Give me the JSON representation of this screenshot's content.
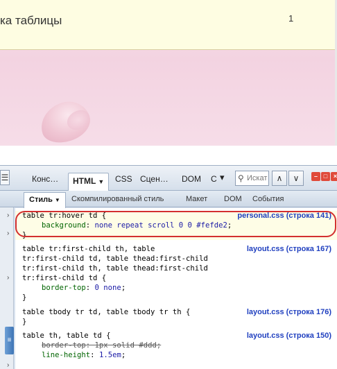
{
  "webpage": {
    "row_text": "ка таблицы",
    "row_number": "1"
  },
  "devtools": {
    "tabs": [
      {
        "label": "Конс…"
      },
      {
        "label": "HTML",
        "active": true
      },
      {
        "label": "CSS"
      },
      {
        "label": "Сцен…"
      },
      {
        "label": "DOM"
      },
      {
        "label": "С"
      }
    ],
    "search_placeholder": "Искат",
    "subtabs": [
      {
        "label": "Стиль",
        "active": true
      },
      {
        "label": "Скомпилированный стиль"
      },
      {
        "label": "Макет"
      },
      {
        "label": "DOM"
      },
      {
        "label": "События"
      }
    ],
    "rules": [
      {
        "selector": [
          "table tr:hover td {"
        ],
        "source": "personal.css (строка 141)",
        "props": [
          {
            "name": "background",
            "value": "none repeat scroll 0 0 #fefde2",
            "overridden": false
          }
        ]
      },
      {
        "selector": [
          "table tr:first-child th, table",
          "tr:first-child td, table thead:first-child",
          "tr:first-child th, table thead:first-child",
          "tr:first-child td {"
        ],
        "source": "layout.css (строка 167)",
        "props": [
          {
            "name": "border-top",
            "value": "0 none",
            "overridden": false
          }
        ]
      },
      {
        "selector": [
          "table tbody tr td, table tbody tr th {"
        ],
        "source": "layout.css (строка 176)",
        "props": []
      },
      {
        "selector": [
          "table th, table td {"
        ],
        "source": "layout.css (строка 150)",
        "props": [
          {
            "name": "border-top",
            "value": "1px solid #ddd",
            "overridden": true
          },
          {
            "name": "line-height",
            "value": "1.5em",
            "overridden": false
          }
        ]
      }
    ]
  },
  "colors": {
    "hover_bg": "#fefde2",
    "highlight": "#d32f2f",
    "source_link": "#1f3fbf"
  }
}
